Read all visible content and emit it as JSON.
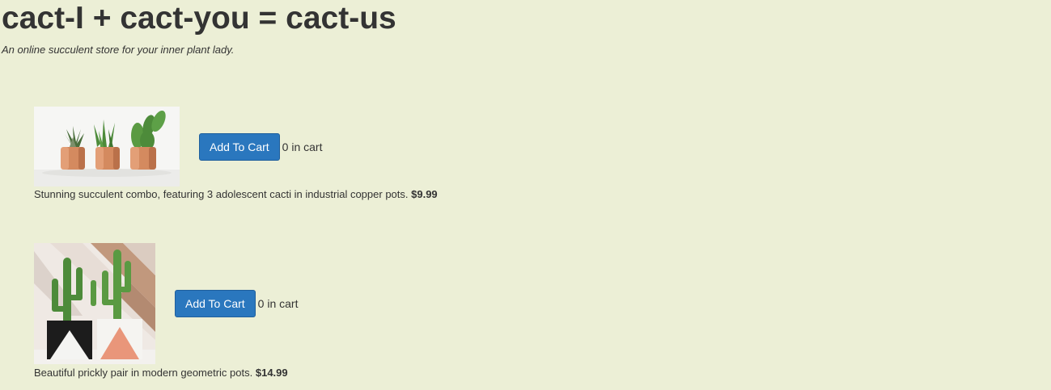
{
  "header": {
    "title": "cact-I + cact-you = cact-us",
    "tagline": "An online succulent store for your inner plant lady."
  },
  "products": [
    {
      "image_icon": "copper-pot-cacti-photo",
      "add_button_label": "Add To Cart",
      "cart_status": "0 in cart",
      "description": "Stunning succulent combo, featuring 3 adolescent cacti in industrial copper pots.",
      "price": "$9.99"
    },
    {
      "image_icon": "geometric-pot-cacti-photo",
      "add_button_label": "Add To Cart",
      "cart_status": "0 in cart",
      "description": "Beautiful prickly pair in modern geometric pots.",
      "price": "$14.99"
    }
  ],
  "colors": {
    "background": "#ecefd6",
    "text": "#333333",
    "button": "#2a77be",
    "button_text": "#ffffff",
    "copper": "#d48a5f",
    "cactus_green": "#4d8b3a"
  }
}
